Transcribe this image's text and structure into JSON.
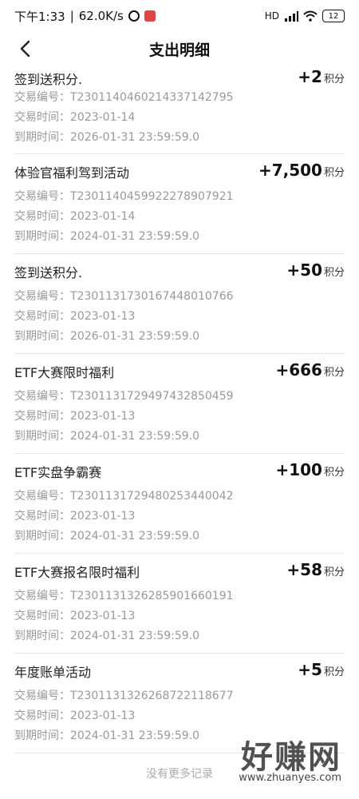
{
  "status": {
    "time": "下午1:33",
    "speed": "62.0K/s",
    "net": "HD",
    "battery": "12"
  },
  "header": {
    "title": "支出明细"
  },
  "labels": {
    "id_label": "交易编号：",
    "date_label": "交易时间：",
    "expire_label": "到期时间：",
    "unit": "积分"
  },
  "records": [
    {
      "name": "签到送积分.",
      "amount": "+2",
      "id": "T230114046021433714 2795",
      "date": "2023-01-14",
      "expire": "2026-01-31 23:59:59.0"
    },
    {
      "name": "体验官福利驾到活动",
      "amount": "+7,500",
      "id": "T230114045992227890 7921",
      "date": "2023-01-14",
      "expire": "2024-01-31 23:59:59.0"
    },
    {
      "name": "签到送积分.",
      "amount": "+50",
      "id": "T230113173016744801 0766",
      "date": "2023-01-13",
      "expire": "2026-01-31 23:59:59.0"
    },
    {
      "name": "ETF大赛限时福利",
      "amount": "+666",
      "id": "T230113172949743285 0459",
      "date": "2023-01-13",
      "expire": "2024-01-31 23:59:59.0"
    },
    {
      "name": "ETF实盘争霸赛",
      "amount": "+100",
      "id": "T230113172948025344 0042",
      "date": "2023-01-13",
      "expire": "2024-01-31 23:59:59.0"
    },
    {
      "name": "ETF大赛报名限时福利",
      "amount": "+58",
      "id": "T230113132628590166 0191",
      "date": "2023-01-13",
      "expire": "2024-01-31 23:59:59.0"
    },
    {
      "name": "年度账单活动",
      "amount": "+5",
      "id": "T230113132626872211 8677",
      "date": "2023-01-13",
      "expire": "2024-01-31 23:59:59.0"
    }
  ],
  "footer": {
    "text": "没有更多记录"
  },
  "watermark": {
    "text": "好赚网",
    "url": "www.zhuanyes.com"
  }
}
